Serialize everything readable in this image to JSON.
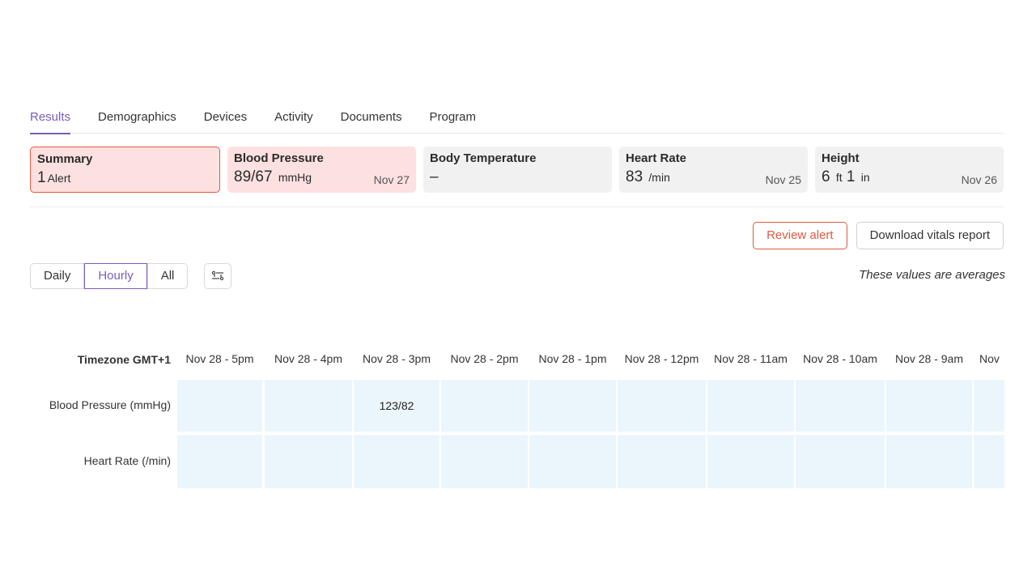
{
  "tabs": [
    {
      "label": "Results",
      "active": true
    },
    {
      "label": "Demographics",
      "active": false
    },
    {
      "label": "Devices",
      "active": false
    },
    {
      "label": "Activity",
      "active": false
    },
    {
      "label": "Documents",
      "active": false
    },
    {
      "label": "Program",
      "active": false
    }
  ],
  "cards": {
    "summary": {
      "title": "Summary",
      "value": "1",
      "unit": "Alert"
    },
    "blood_pressure": {
      "title": "Blood Pressure",
      "value": "89/67",
      "unit": "mmHg",
      "date": "Nov 27"
    },
    "body_temperature": {
      "title": "Body Temperature",
      "value": "–"
    },
    "heart_rate": {
      "title": "Heart Rate",
      "value": "83",
      "unit": "/min",
      "date": "Nov 25"
    },
    "height": {
      "title": "Height",
      "value_ft": "6",
      "unit_ft": "ft",
      "value_in": "1",
      "unit_in": "in",
      "date": "Nov 26"
    }
  },
  "actions": {
    "review": "Review alert",
    "download": "Download vitals report"
  },
  "range": {
    "daily": "Daily",
    "hourly": "Hourly",
    "all": "All"
  },
  "note": "These values are averages",
  "table": {
    "timezone": "Timezone GMT+1",
    "columns": [
      "Nov 28 - 5pm",
      "Nov 28 - 4pm",
      "Nov 28 - 3pm",
      "Nov 28 - 2pm",
      "Nov 28 - 1pm",
      "Nov 28 - 12pm",
      "Nov 28 - 11am",
      "Nov 28 - 10am",
      "Nov 28 - 9am",
      "Nov"
    ],
    "rows": [
      {
        "label": "Blood Pressure (mmHg)",
        "values": [
          "",
          "",
          "123/82",
          "",
          "",
          "",
          "",
          "",
          "",
          ""
        ]
      },
      {
        "label": "Heart Rate (/min)",
        "values": [
          "",
          "",
          "",
          "",
          "",
          "",
          "",
          "",
          "",
          ""
        ]
      }
    ]
  },
  "colors": {
    "accent": "#7b5cb8",
    "alert": "#e05a3e",
    "alert_bg": "#fde0e0",
    "cell_bg": "#ebf6fc"
  }
}
